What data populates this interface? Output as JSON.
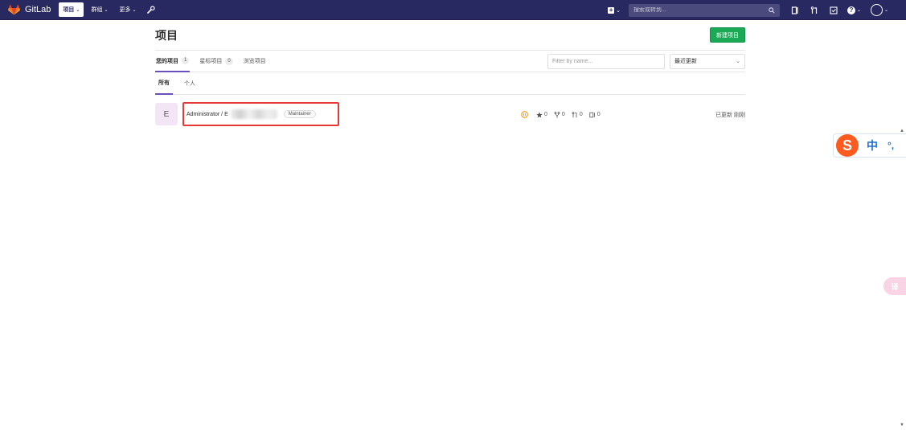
{
  "navbar": {
    "brand": "GitLab",
    "items": [
      {
        "label": "项目",
        "active": true
      },
      {
        "label": "群组",
        "active": false
      },
      {
        "label": "更多",
        "active": false
      }
    ],
    "search_placeholder": "搜索或转到..."
  },
  "page": {
    "title": "项目",
    "new_project_label": "新建项目",
    "tabs": [
      {
        "label": "您的项目",
        "count": "1",
        "active": true
      },
      {
        "label": "星标项目",
        "count": "0",
        "active": false
      },
      {
        "label": "浏览项目",
        "count": "",
        "active": false
      }
    ],
    "filter_placeholder": "Filter by name...",
    "sort_label": "最近更新",
    "sub_tabs": [
      {
        "label": "所有",
        "active": true
      },
      {
        "label": "个人",
        "active": false
      }
    ]
  },
  "projects": [
    {
      "avatar_letter": "E",
      "name": "Administrator / E",
      "role": "Maintainer",
      "stars": "0",
      "forks": "0",
      "merge_requests": "0",
      "issues": "0",
      "updated": "已更新 刚刚"
    }
  ],
  "ime": {
    "logo": "S",
    "mode": "中",
    "punct": "°,"
  },
  "translate": {
    "label": "译"
  },
  "colors": {
    "navbar": "#292961",
    "primary_button": "#1aaa55",
    "active_tab": "#6b4fbb",
    "highlight_box": "#e53935"
  }
}
